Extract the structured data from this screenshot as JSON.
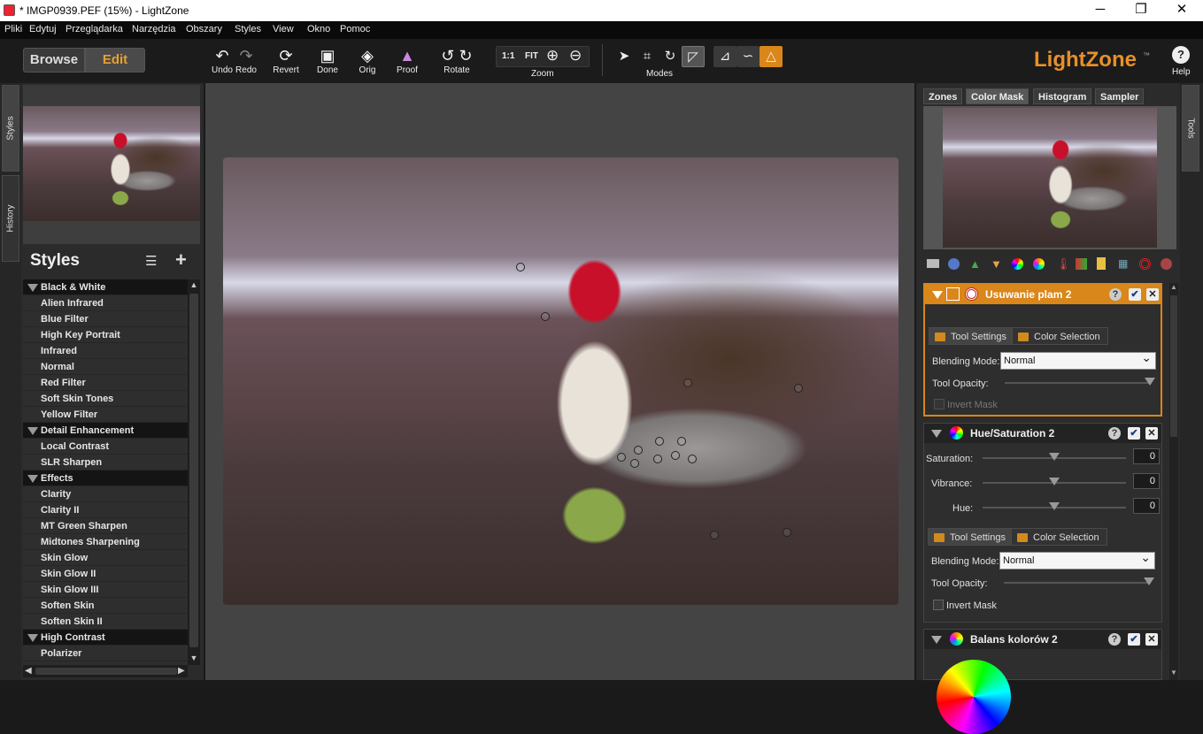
{
  "window": {
    "title": "* IMGP0939.PEF (15%) - LightZone",
    "min": "─",
    "max": "❐",
    "close": "✕"
  },
  "menu": [
    "Pliki",
    "Edytuj",
    "Przeglądarka",
    "Narzędzia",
    "Obszary",
    "Styles",
    "View",
    "Okno",
    "Pomoc"
  ],
  "toolbar": {
    "browse": "Browse",
    "edit": "Edit",
    "undo": "Undo",
    "redo": "Redo",
    "revert": "Revert",
    "done": "Done",
    "orig": "Orig",
    "proof": "Proof",
    "rotate": "Rotate",
    "zoom": "Zoom",
    "zoom_1to1": "1:1",
    "zoom_fit": "FIT",
    "modes": "Modes",
    "brand": "LightZone",
    "brand_tm": "™",
    "help": "Help",
    "help_glyph": "?"
  },
  "left": {
    "tab_styles": "Styles",
    "tab_history": "History",
    "styles_title": "Styles",
    "styles": [
      {
        "label": "Black & White",
        "category": true
      },
      {
        "label": "Alien Infrared"
      },
      {
        "label": "Blue Filter"
      },
      {
        "label": "High Key Portrait"
      },
      {
        "label": "Infrared"
      },
      {
        "label": "Normal"
      },
      {
        "label": "Red Filter"
      },
      {
        "label": "Soft Skin Tones"
      },
      {
        "label": "Yellow Filter"
      },
      {
        "label": "Detail Enhancement",
        "category": true
      },
      {
        "label": "Local Contrast"
      },
      {
        "label": "SLR Sharpen"
      },
      {
        "label": "Effects",
        "category": true
      },
      {
        "label": "Clarity"
      },
      {
        "label": "Clarity II"
      },
      {
        "label": "MT Green Sharpen"
      },
      {
        "label": "Midtones Sharpening"
      },
      {
        "label": "Skin Glow"
      },
      {
        "label": "Skin Glow II"
      },
      {
        "label": "Skin Glow III"
      },
      {
        "label": "Soften Skin"
      },
      {
        "label": "Soften Skin II"
      },
      {
        "label": "High Contrast",
        "category": true
      },
      {
        "label": "Polarizer"
      }
    ]
  },
  "right": {
    "tabs": [
      "Zones",
      "Color Mask",
      "Histogram",
      "Sampler"
    ],
    "active_tab": "Color Mask",
    "tab_tools": "Tools",
    "tool1": {
      "name": "Usuwanie plam 2",
      "color": "#d9861a",
      "tab_settings": "Tool Settings",
      "tab_color": "Color Selection",
      "blending_label": "Blending Mode:",
      "blending_value": "Normal",
      "opacity_label": "Tool Opacity:",
      "opacity": 1.0,
      "invert": "Invert Mask"
    },
    "tool2": {
      "name": "Hue/Saturation 2",
      "saturation_label": "Saturation:",
      "saturation": "0",
      "vibrance_label": "Vibrance:",
      "vibrance": "0",
      "hue_label": "Hue:",
      "hue": "0",
      "tab_settings": "Tool Settings",
      "tab_color": "Color Selection",
      "blending_label": "Blending Mode:",
      "blending_value": "Normal",
      "opacity_label": "Tool Opacity:",
      "opacity": 1.0,
      "invert": "Invert Mask"
    },
    "tool3": {
      "name": "Balans kolorów 2"
    },
    "help_glyph": "?",
    "check_glyph": "✔",
    "close_glyph": "✕"
  }
}
